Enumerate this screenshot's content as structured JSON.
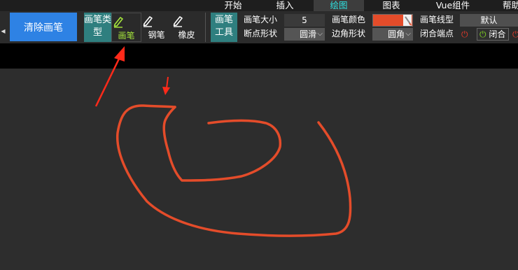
{
  "menu": {
    "tabs": [
      {
        "label": "开始",
        "active": false
      },
      {
        "label": "插入",
        "active": false
      },
      {
        "label": "绘图",
        "active": true
      },
      {
        "label": "图表",
        "active": false
      },
      {
        "label": "Vue组件",
        "active": false
      },
      {
        "label": "帮助",
        "active": false
      }
    ]
  },
  "ribbon": {
    "clear_button": "清除画笔",
    "pen_type_label": "画笔类型",
    "tools": [
      {
        "label": "画笔",
        "icon": "pen-icon",
        "active": true
      },
      {
        "label": "钢笔",
        "icon": "fountain-pen-icon",
        "active": false
      },
      {
        "label": "橡皮",
        "icon": "eraser-icon",
        "active": false
      }
    ],
    "pen_tool_label": "画笔工具",
    "pen_size_label": "画笔大小",
    "pen_size_value": "5",
    "cap_label": "断点形状",
    "cap_value": "圆滑",
    "pen_color_label": "画笔颜色",
    "pen_color": "#e44c2a",
    "corner_label": "边角形状",
    "corner_value": "圆角",
    "line_type_label": "画笔线型",
    "line_type_value": "默认",
    "closed_label": "闭合端点",
    "closed_button": "闭合"
  },
  "colors": {
    "accent_tab": "#2fe0e0",
    "active_tool": "#a7e83c",
    "clear_button_bg": "#2e82e4",
    "group_label_bg": "#2f7f7f",
    "stroke": "#e44c2a",
    "annotation_arrow": "#ff2a1a",
    "power_off": "#e43a2a",
    "power_on": "#7ed321"
  }
}
